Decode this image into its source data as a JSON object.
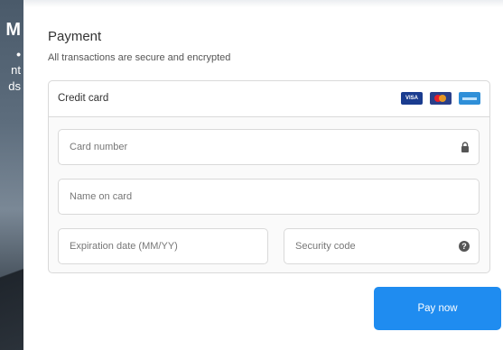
{
  "background": {
    "lines": [
      "M",
      "•",
      "nt",
      "ds"
    ]
  },
  "payment": {
    "title": "Payment",
    "subtitle": "All transactions are secure and encrypted",
    "method_label": "Credit card",
    "brands": [
      "VISA",
      "Mastercard",
      "American Express"
    ],
    "fields": {
      "card_number": {
        "placeholder": "Card number",
        "icon": "lock-icon"
      },
      "name_on_card": {
        "placeholder": "Name on card"
      },
      "expiration": {
        "placeholder": "Expiration date (MM/YY)"
      },
      "security_code": {
        "placeholder": "Security code",
        "icon": "help-icon"
      }
    },
    "submit_label": "Pay now"
  },
  "colors": {
    "accent": "#1f8cf0",
    "border": "#d9d9d9"
  }
}
